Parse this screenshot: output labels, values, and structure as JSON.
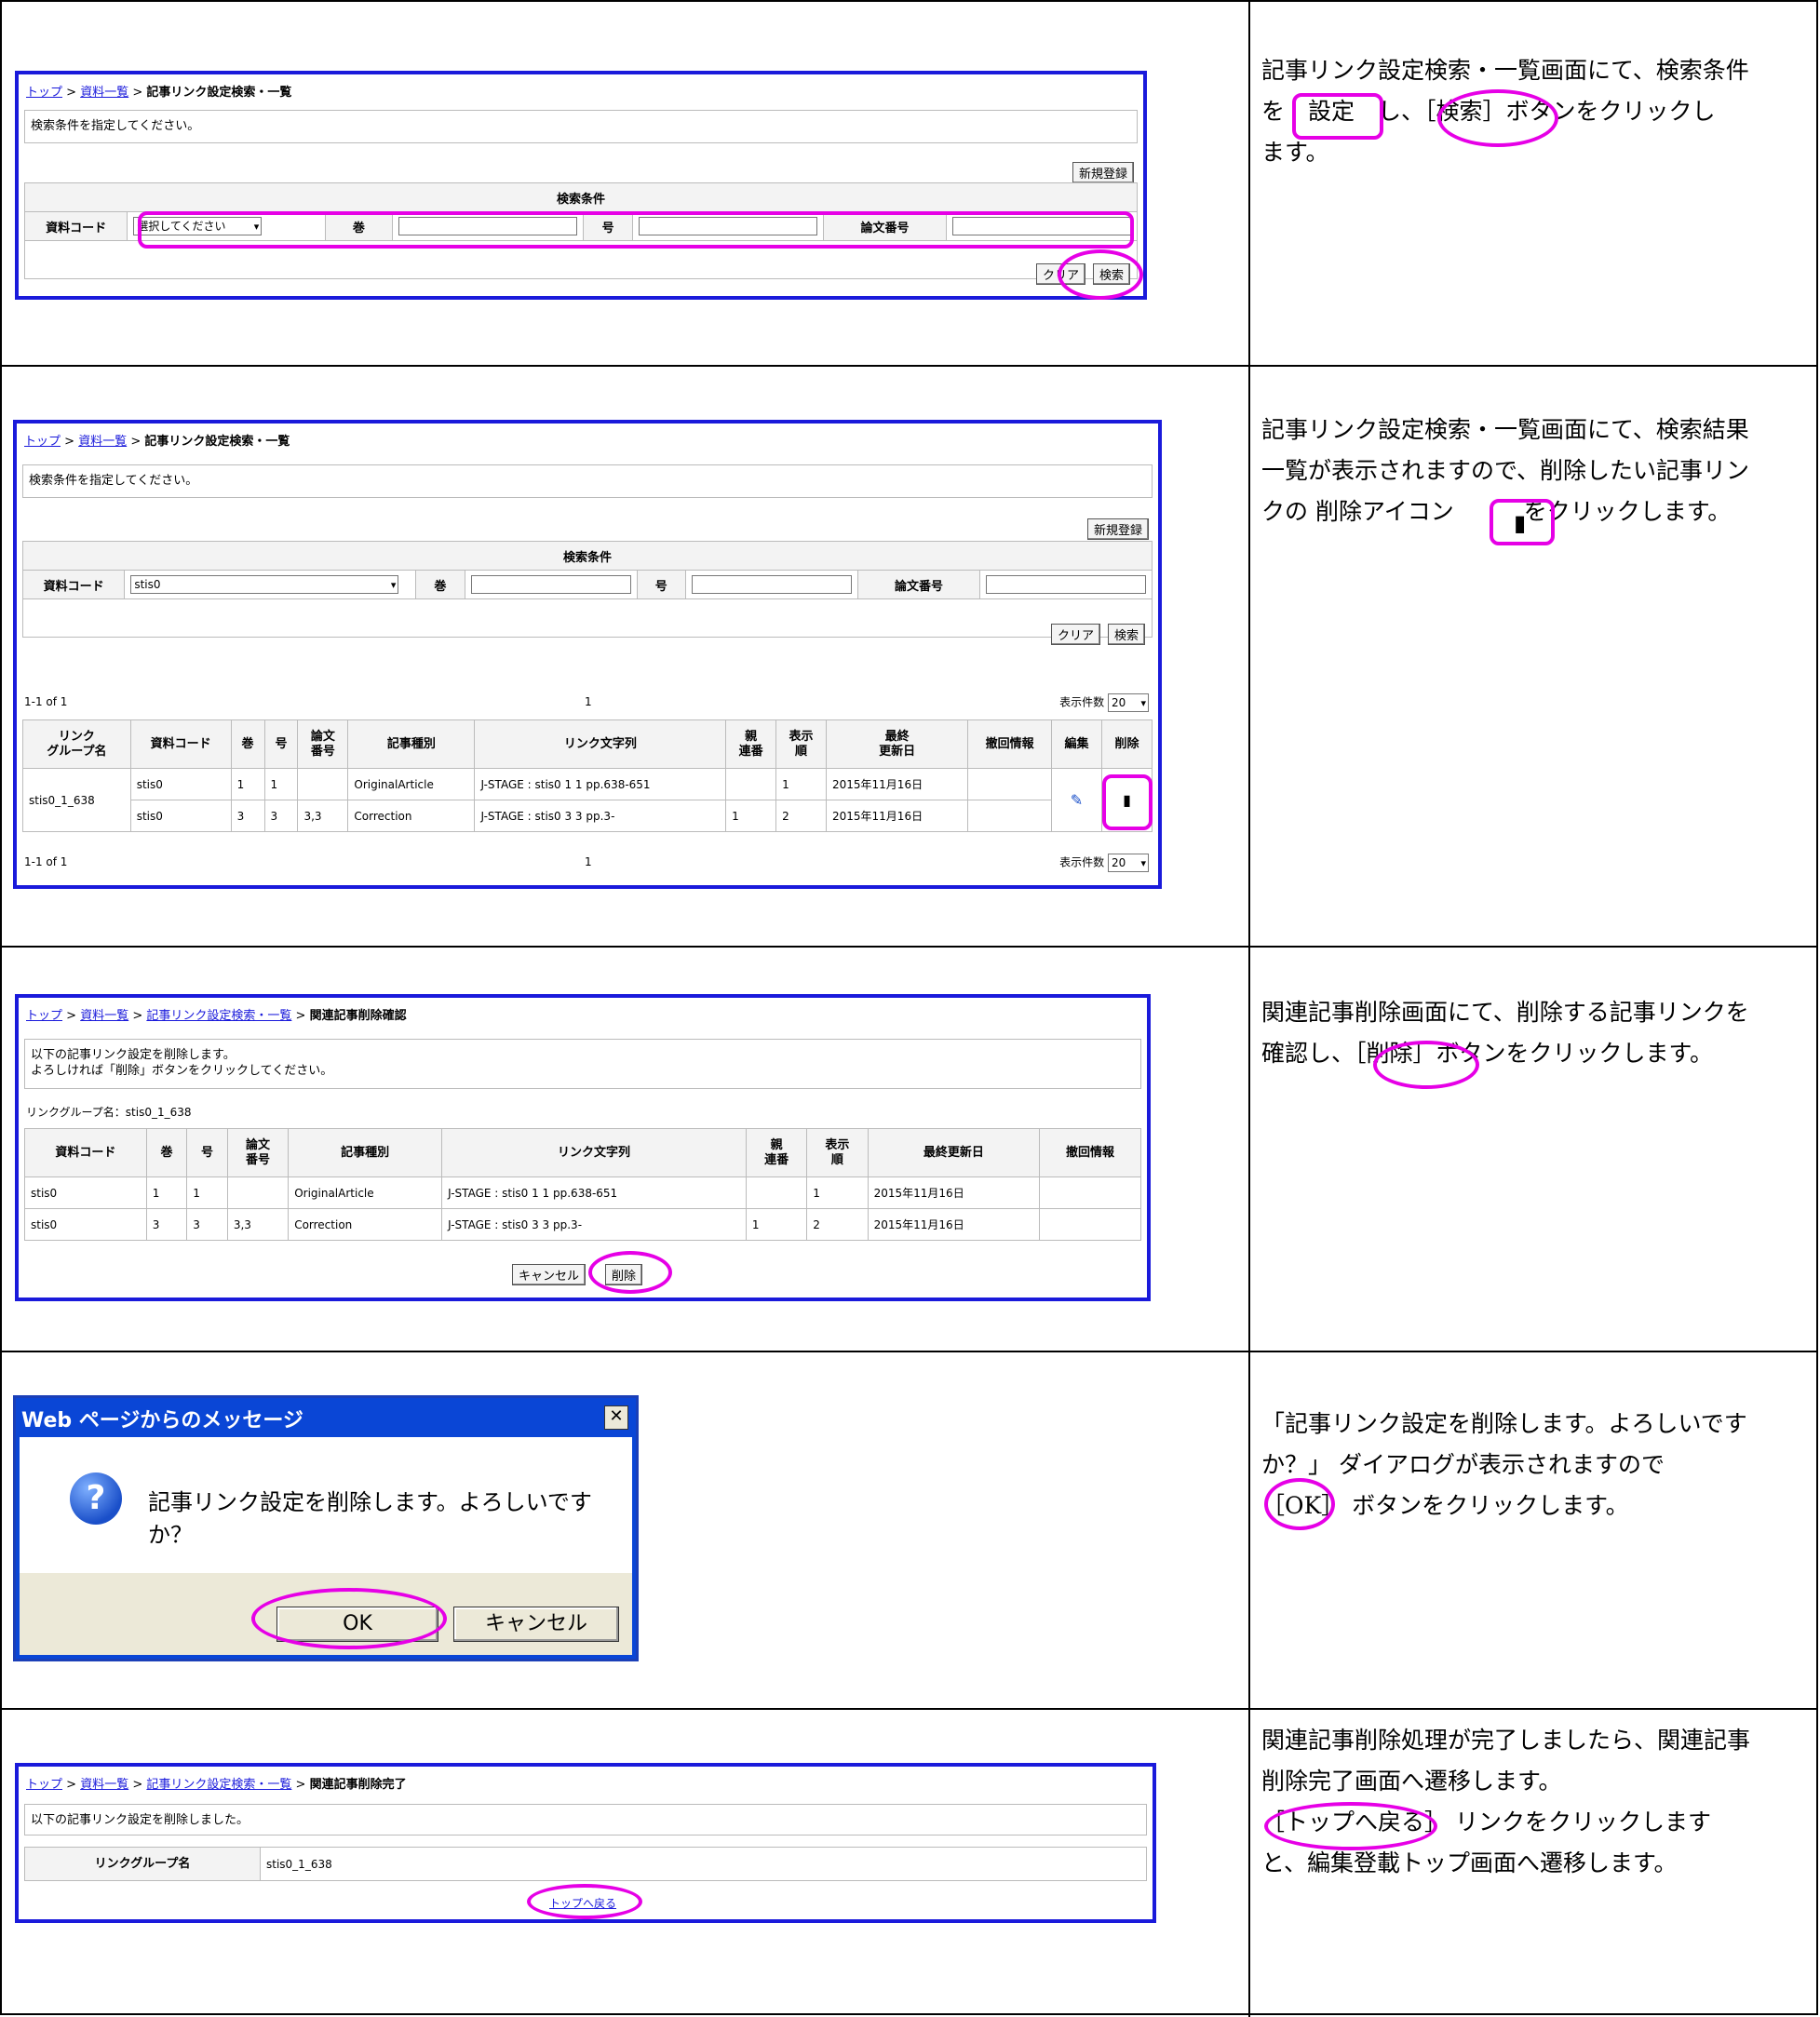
{
  "steps": [
    {
      "desc": [
        "記事リンク設定検索・一覧画面にて、検索条件",
        "を　設定　し、［検索］ボタンをクリックし",
        "ます。"
      ],
      "crumb": {
        "top": "トップ",
        "list": "資料一覧",
        "current": "記事リンク設定検索・一覧"
      },
      "message": "検索条件を指定してください。",
      "new_button": "新規登録",
      "cond_title": "検索条件",
      "fields": {
        "code_label": "資料コード",
        "code_value": "選択してください",
        "vol_label": "巻",
        "no_label": "号",
        "paper_label": "論文番号"
      },
      "clear_button": "クリア",
      "search_button": "検索"
    },
    {
      "desc": [
        "記事リンク設定検索・一覧画面にて、検索結果",
        "一覧が表示されますので、削除したい記事リン",
        "クの 削除アイコン　　　をクリックします。"
      ],
      "crumb": {
        "top": "トップ",
        "list": "資料一覧",
        "current": "記事リンク設定検索・一覧"
      },
      "message": "検索条件を指定してください。",
      "new_button": "新規登録",
      "cond_title": "検索条件",
      "fields": {
        "code_label": "資料コード",
        "code_value": "stis0",
        "vol_label": "巻",
        "no_label": "号",
        "paper_label": "論文番号"
      },
      "clear_button": "クリア",
      "search_button": "検索",
      "paging": {
        "range": "1-1 of 1",
        "page": "1",
        "count_label": "表示件数",
        "count_value": "20"
      },
      "headers": [
        "リンク\nグループ名",
        "資料コード",
        "巻",
        "号",
        "論文\n番号",
        "記事種別",
        "リンク文字列",
        "親\n連番",
        "表示\n順",
        "最終\n更新日",
        "撤回情報",
        "編集",
        "削除"
      ],
      "group": "stis0_1_638",
      "rows": [
        [
          "stis0",
          "1",
          "1",
          "",
          "OriginalArticle",
          "J-STAGE : stis0 1 1 pp.638-651",
          "",
          "1",
          "2015年11月16日",
          ""
        ],
        [
          "stis0",
          "3",
          "3",
          "3,3",
          "Correction",
          "J-STAGE : stis0 3 3 pp.3-",
          "1",
          "2",
          "2015年11月16日",
          ""
        ]
      ]
    },
    {
      "desc": [
        "関連記事削除画面にて、削除する記事リンクを",
        "確認し、［削除］ボタンをクリックします。"
      ],
      "crumb": {
        "top": "トップ",
        "list": "資料一覧",
        "search": "記事リンク設定検索・一覧",
        "current": "関連記事削除確認"
      },
      "message": [
        "以下の記事リンク設定を削除します。",
        "よろしければ「削除」ボタンをクリックしてください。"
      ],
      "group_label": "リンクグループ名：stis0_1_638",
      "headers": [
        "資料コード",
        "巻",
        "号",
        "論文\n番号",
        "記事種別",
        "リンク文字列",
        "親\n連番",
        "表示\n順",
        "最終更新日",
        "撤回情報"
      ],
      "rows": [
        [
          "stis0",
          "1",
          "1",
          "",
          "OriginalArticle",
          "J-STAGE : stis0 1 1 pp.638-651",
          "",
          "1",
          "2015年11月16日",
          ""
        ],
        [
          "stis0",
          "3",
          "3",
          "3,3",
          "Correction",
          "J-STAGE : stis0 3 3 pp.3-",
          "1",
          "2",
          "2015年11月16日",
          ""
        ]
      ],
      "cancel_button": "キャンセル",
      "delete_button": "削除"
    },
    {
      "desc": [
        "「記事リンク設定を削除します。よろしいです",
        "か？」 ダイアログが表示されますので",
        "［OK］ ボタンをクリックします。"
      ],
      "dialog_title": "Web ページからのメッセージ",
      "dialog_message": "記事リンク設定を削除します。よろしいですか？",
      "ok_button": "OK",
      "cancel_button": "キャンセル"
    },
    {
      "desc": [
        "関連記事削除処理が完了しましたら、関連記事",
        "削除完了画面へ遷移します。",
        "［トップへ戻る］ リンクをクリックします",
        "と、編集登載トップ画面へ遷移します。"
      ],
      "crumb": {
        "top": "トップ",
        "list": "資料一覧",
        "search": "記事リンク設定検索・一覧",
        "current": "関連記事削除完了"
      },
      "message": "以下の記事リンク設定を削除しました。",
      "group_label": "リンクグループ名",
      "group_value": "stis0_1_638",
      "back_link": "トップへ戻る"
    }
  ],
  "colors": {
    "highlight": "#e600e6",
    "frame": "#1a1adb"
  }
}
